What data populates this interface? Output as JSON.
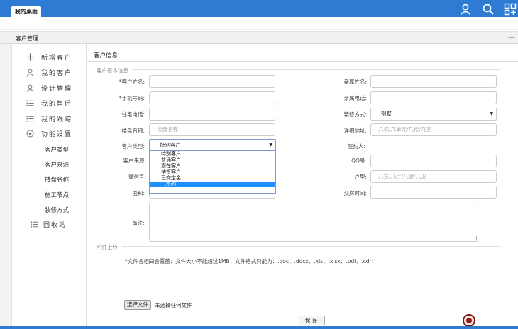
{
  "topbar": {
    "tab_label": "我的桌面",
    "icons": [
      "user-icon",
      "search-icon",
      "apps-icon"
    ]
  },
  "panel": {
    "title": "客户管理",
    "minimize": "—"
  },
  "sidebar": {
    "items": [
      {
        "label": "新增客户",
        "icon": "plus-icon"
      },
      {
        "label": "我的客户",
        "icon": "user-icon"
      },
      {
        "label": "设计管理",
        "icon": "user-icon"
      },
      {
        "label": "我的售后",
        "icon": "list-icon"
      },
      {
        "label": "我的跟踪",
        "icon": "list-icon"
      },
      {
        "label": "功能设置",
        "icon": "settings-icon"
      }
    ],
    "sub_items": [
      "客户类型",
      "客户来源",
      "楼盘名称",
      "施工节点",
      "装修方式"
    ],
    "last_item": {
      "label": "回收站",
      "icon": "list-icon"
    }
  },
  "main": {
    "title": "客户信息",
    "section_basic": "客户基本信息",
    "section_attach": "附件上传",
    "labels": {
      "customer_name": "*客户姓名:",
      "mobile": "*手机号码:",
      "home_phone": "住宅电话:",
      "building_name": "楼盘名称:",
      "customer_type": "客户类型:",
      "customer_source": "客户来源:",
      "wechat": "微信号:",
      "area": "面积:",
      "remark": "备注:",
      "family_name": "亲属姓名:",
      "family_phone": "亲属电话:",
      "decoration_method": "装修方式:",
      "detail_address": "详细地址:",
      "signer": "签约人:",
      "qq": "QQ号:",
      "house_type": "户型:",
      "delivery_time": "交房时间:"
    },
    "placeholders": {
      "building_name": "楼盘名称",
      "detail_address": "几栋/几单元/几楼/几室",
      "house_type": "几室/几厅/几厨/几卫"
    },
    "values": {
      "decoration_method": "别墅",
      "customer_type": "特别客户"
    },
    "customer_type_options": [
      "特别客户",
      "普通客户",
      "潜在客户",
      "待签客户",
      "已交定金",
      "已签约"
    ],
    "customer_type_highlighted": "已签约",
    "note": "*文件名相同会覆盖：文件大小不能超过1MB；文件格式只能为：.doc、.docx、.xls、.xlsx、.pdf、.cdr!",
    "file_button": "选择文件",
    "file_status": "未选择任何文件",
    "save_button": "保存"
  },
  "colors": {
    "accent": "#2d7bd3",
    "highlight": "#1e90ff"
  }
}
